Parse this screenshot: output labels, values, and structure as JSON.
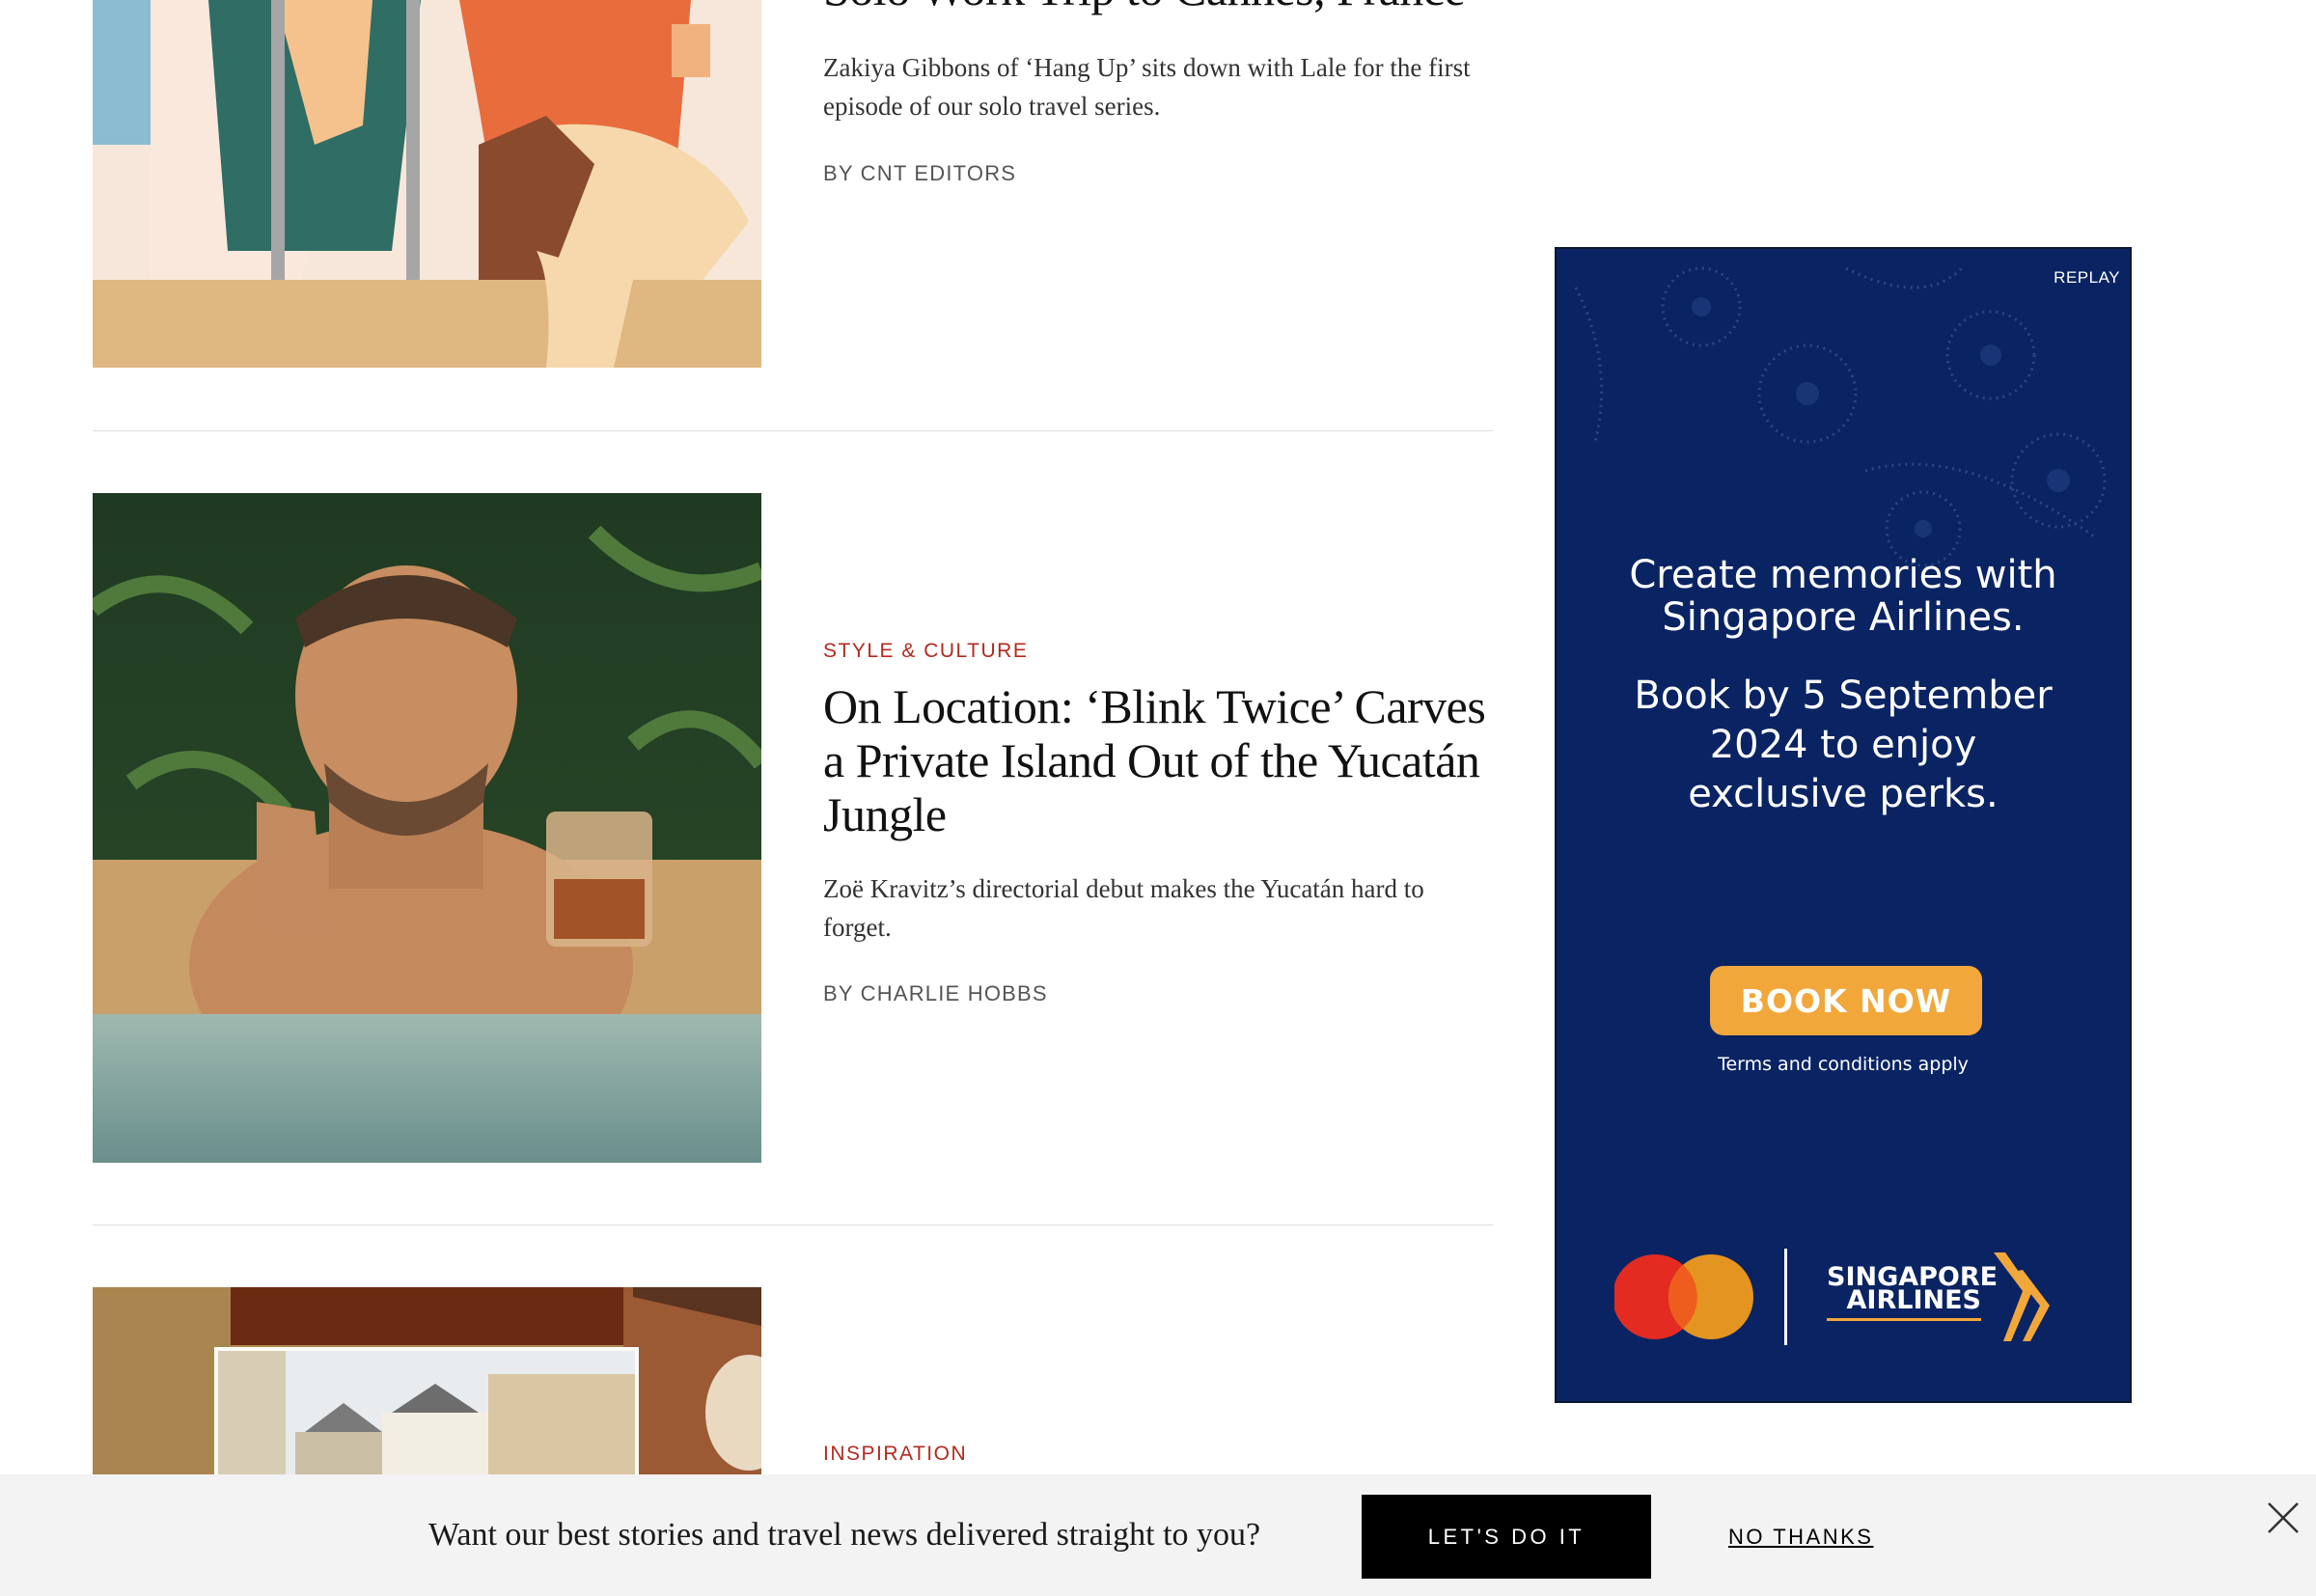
{
  "stories": [
    {
      "rubric": "",
      "headline": "Solo Work Trip to Cannes, France",
      "dek": "Zakiya Gibbons of ‘Hang Up’ sits down with Lale for the first episode of our solo travel series.",
      "byline": "BY CNT EDITORS",
      "image": "illustration-two-women-icon"
    },
    {
      "rubric": "STYLE & CULTURE",
      "headline": "On Location: ‘Blink Twice’ Carves a Private Island Out of the Yucatán Jungle",
      "dek": "Zoë Kravitz’s directorial debut makes the Yucatán hard to forget.",
      "byline": "BY CHARLIE HOBBS",
      "image": "man-in-pool-with-drink-photo"
    },
    {
      "rubric": "INSPIRATION",
      "headline": "",
      "dek": "",
      "byline": "",
      "image": "town-street-collage-photo"
    }
  ],
  "ad": {
    "replay_label": "REPLAY",
    "headline": "Create memories with Singapore Airlines.",
    "offer": "Book by 5 September 2024 to enjoy exclusive perks.",
    "cta_label": "BOOK NOW",
    "terms": "Terms and conditions apply",
    "brand_top": "SINGAPORE",
    "brand_bottom": "AIRLINES",
    "colors": {
      "background": "#0a2463",
      "cta": "#f2a73b",
      "mastercard_red": "#e32b22",
      "mastercard_orange": "#f79e1b"
    }
  },
  "newsletter": {
    "prompt": "Want our best stories and travel news delivered straight to you?",
    "cta_label": "LET'S DO IT",
    "decline_label": "NO THANKS",
    "close_icon": "close-icon"
  }
}
